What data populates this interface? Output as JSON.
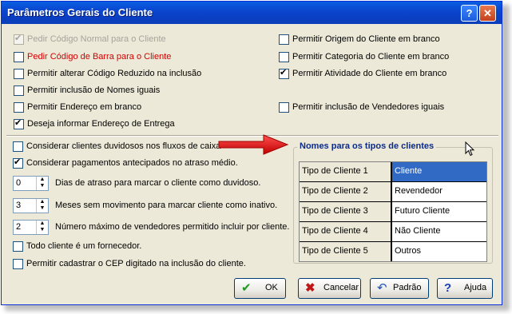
{
  "window": {
    "title": "Parâmetros Gerais do Cliente",
    "help_glyph": "?",
    "close_glyph": "✕"
  },
  "options_left": [
    {
      "label": "Pedir Código Normal para o Cliente",
      "checked": true,
      "disabled": true
    },
    {
      "label": "Pedir Código de Barra para o Cliente",
      "checked": false,
      "red": true
    },
    {
      "label": "Permitir alterar Código Reduzido na inclusão",
      "checked": false
    },
    {
      "label": "Permitir inclusão de Nomes iguais",
      "checked": false
    },
    {
      "label": "Permitir Endereço em branco",
      "checked": false
    },
    {
      "label": "Deseja informar Endereço de Entrega",
      "checked": true
    }
  ],
  "options_right": [
    {
      "label": "Permitir Origem do Cliente em branco",
      "checked": false
    },
    {
      "label": "Permitir Categoria do Cliente em branco",
      "checked": false
    },
    {
      "label": "Permitir Atividade do Cliente em branco",
      "checked": true
    },
    {
      "label": "Permitir inclusão de Vendedores iguais",
      "checked": false
    }
  ],
  "options_lower": [
    {
      "label": "Considerar clientes duvidosos nos fluxos de caixa",
      "checked": false
    },
    {
      "label": "Considerar pagamentos antecipados no atraso médio.",
      "checked": true
    }
  ],
  "spinners": [
    {
      "value": "0",
      "label": "Dias de atraso para marcar o cliente como duvidoso."
    },
    {
      "value": "3",
      "label": "Meses sem movimento para marcar cliente como inativo."
    },
    {
      "value": "2",
      "label": "Número máximo de vendedores permitido incluir por cliente."
    }
  ],
  "options_bottom": [
    {
      "label": "Todo cliente é um fornecedor.",
      "checked": false
    },
    {
      "label": "Permitir cadastrar o CEP digitado na inclusão do cliente.",
      "checked": false
    }
  ],
  "client_types": {
    "title": "Nomes para os tipos de clientes",
    "rows": [
      {
        "key": "Tipo de Cliente 1",
        "value": "Cliente",
        "selected": true
      },
      {
        "key": "Tipo de Cliente 2",
        "value": "Revendedor"
      },
      {
        "key": "Tipo de Cliente 3",
        "value": "Futuro Cliente"
      },
      {
        "key": "Tipo de Cliente 4",
        "value": "Não Cliente"
      },
      {
        "key": "Tipo de Cliente 5",
        "value": "Outros"
      }
    ]
  },
  "buttons": {
    "ok": "OK",
    "cancel": "Cancelar",
    "default": "Padrão",
    "help": "Ajuda"
  },
  "colors": {
    "title_bar": "#0a46cf",
    "selection": "#316ac5",
    "arrow": "#e00000",
    "group_title": "#0b2a8c"
  }
}
